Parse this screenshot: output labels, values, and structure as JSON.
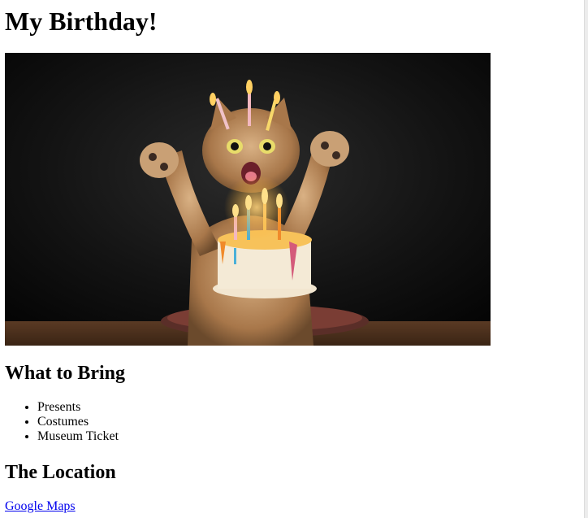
{
  "page": {
    "title": "My Birthday!"
  },
  "hero_image": {
    "subject": "cat with raised paws behind a birthday cake with lit candles"
  },
  "bring_section": {
    "heading": "What to Bring",
    "items": [
      "Presents",
      "Costumes",
      "Museum Ticket"
    ]
  },
  "location_section": {
    "heading": "The Location",
    "link_text": "Google Maps"
  },
  "colors": {
    "link": "#0000ee",
    "text": "#000000",
    "background": "#ffffff"
  }
}
